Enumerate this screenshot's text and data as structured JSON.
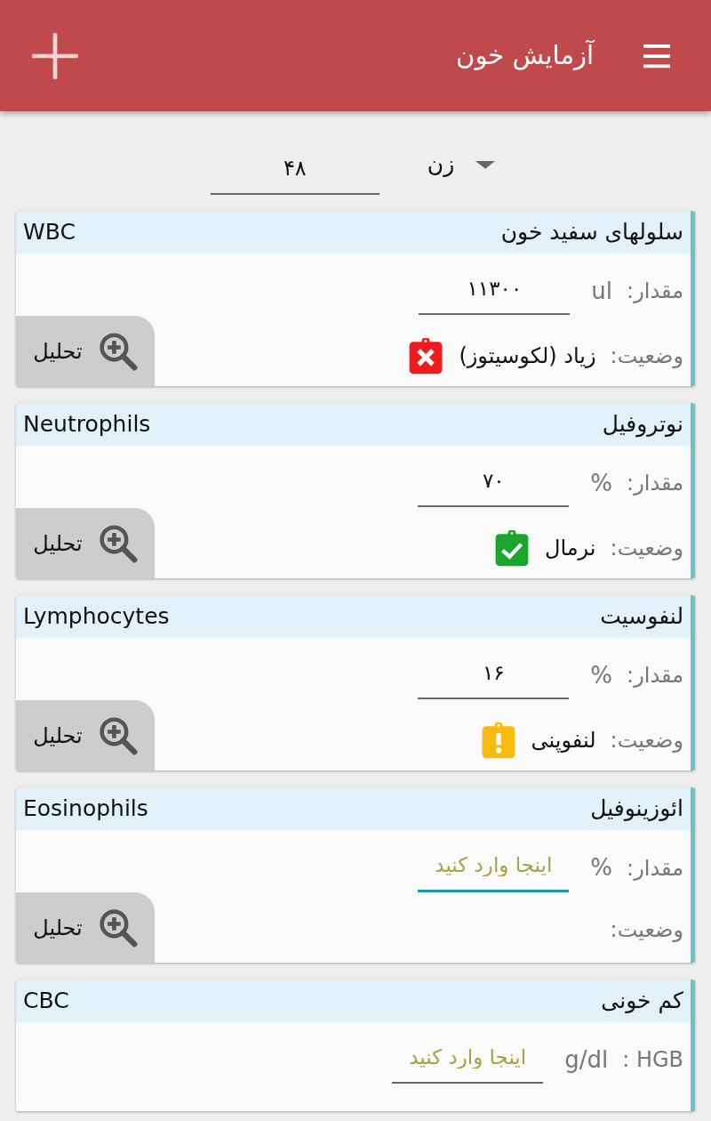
{
  "app_bar": {
    "title": "آزمایش خون"
  },
  "patient": {
    "gender": "زن",
    "age": "۴۸"
  },
  "cards": [
    {
      "title": "سلولهای سفید خون",
      "title_en": "WBC",
      "value_label": "مقدار:",
      "unit": "ul",
      "value": "۱۱۳۰۰",
      "focused": false,
      "status_label": "وضعیت:",
      "status": {
        "kind": "high",
        "text": "زیاد (لکوسیتوز)"
      },
      "button": "تحلیل"
    },
    {
      "title": "نوتروفیل",
      "title_en": "Neutrophils",
      "value_label": "مقدار:",
      "unit": "%",
      "value": "۷۰",
      "focused": false,
      "status_label": "وضعیت:",
      "status": {
        "kind": "normal",
        "text": "نرمال"
      },
      "button": "تحلیل"
    },
    {
      "title": "لنفوسیت",
      "title_en": "Lymphocytes",
      "value_label": "مقدار:",
      "unit": "%",
      "value": "۱۶",
      "focused": false,
      "status_label": "وضعیت:",
      "status": {
        "kind": "low",
        "text": "لنفوپنی"
      },
      "button": "تحلیل"
    },
    {
      "title": "ائوزینوفیل",
      "title_en": "Eosinophils",
      "value_label": "مقدار:",
      "unit": "%",
      "placeholder": "اینجا وارد کنید",
      "focused": true,
      "status_label": "وضعیت:",
      "button": "تحلیل"
    },
    {
      "title": "کم خونی",
      "title_en": "CBC",
      "value_label": "HGB :",
      "unit": "g/dl",
      "placeholder": "اینجا وارد کنید",
      "focused": false
    }
  ]
}
